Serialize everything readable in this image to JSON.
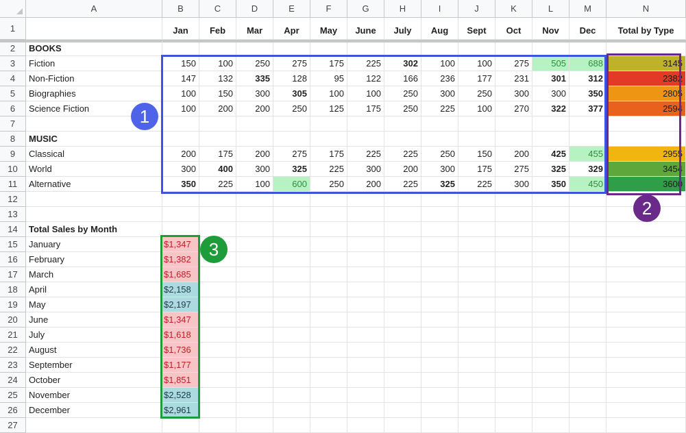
{
  "columns": [
    "A",
    "B",
    "C",
    "D",
    "E",
    "F",
    "G",
    "H",
    "I",
    "J",
    "K",
    "L",
    "M",
    "N"
  ],
  "rows": [
    "1",
    "2",
    "3",
    "4",
    "5",
    "6",
    "7",
    "8",
    "9",
    "10",
    "11",
    "12",
    "13",
    "14",
    "15",
    "16",
    "17",
    "18",
    "19",
    "20",
    "21",
    "22",
    "23",
    "24",
    "25",
    "26",
    "27"
  ],
  "month_headers": [
    "Jan",
    "Feb",
    "Mar",
    "Apr",
    "May",
    "June",
    "July",
    "Aug",
    "Sept",
    "Oct",
    "Nov",
    "Dec"
  ],
  "total_header": "Total by Type",
  "sections": {
    "books": "BOOKS",
    "music": "MUSIC"
  },
  "data_rows": [
    {
      "label": "Fiction",
      "values": [
        "150",
        "100",
        "250",
        "275",
        "175",
        "225",
        "302",
        "100",
        "100",
        "275",
        "505",
        "688"
      ],
      "bold": [
        false,
        false,
        false,
        false,
        false,
        false,
        true,
        false,
        false,
        false,
        false,
        false
      ],
      "green": [
        false,
        false,
        false,
        false,
        false,
        false,
        false,
        false,
        false,
        false,
        true,
        true
      ],
      "total": "3145",
      "total_color": "#bfb12a"
    },
    {
      "label": "Non-Fiction",
      "values": [
        "147",
        "132",
        "335",
        "128",
        "95",
        "122",
        "166",
        "236",
        "177",
        "231",
        "301",
        "312"
      ],
      "bold": [
        false,
        false,
        true,
        false,
        false,
        false,
        false,
        false,
        false,
        false,
        true,
        true
      ],
      "green": [
        false,
        false,
        false,
        false,
        false,
        false,
        false,
        false,
        false,
        false,
        false,
        false
      ],
      "total": "2382",
      "total_color": "#e23a26"
    },
    {
      "label": "Biographies",
      "values": [
        "100",
        "150",
        "300",
        "305",
        "100",
        "100",
        "250",
        "300",
        "250",
        "300",
        "300",
        "350"
      ],
      "bold": [
        false,
        false,
        false,
        true,
        false,
        false,
        false,
        false,
        false,
        false,
        false,
        true
      ],
      "green": [
        false,
        false,
        false,
        false,
        false,
        false,
        false,
        false,
        false,
        false,
        false,
        false
      ],
      "total": "2805",
      "total_color": "#ee9613"
    },
    {
      "label": "Science Fiction",
      "values": [
        "100",
        "200",
        "200",
        "250",
        "125",
        "175",
        "250",
        "225",
        "100",
        "270",
        "322",
        "377"
      ],
      "bold": [
        false,
        false,
        false,
        false,
        false,
        false,
        false,
        false,
        false,
        false,
        true,
        true
      ],
      "green": [
        false,
        false,
        false,
        false,
        false,
        false,
        false,
        false,
        false,
        false,
        false,
        false
      ],
      "total": "2594",
      "total_color": "#e8621e"
    },
    {
      "label": "Classical",
      "values": [
        "200",
        "175",
        "200",
        "275",
        "175",
        "225",
        "225",
        "250",
        "150",
        "200",
        "425",
        "455"
      ],
      "bold": [
        false,
        false,
        false,
        false,
        false,
        false,
        false,
        false,
        false,
        false,
        true,
        false
      ],
      "green": [
        false,
        false,
        false,
        false,
        false,
        false,
        false,
        false,
        false,
        false,
        false,
        true
      ],
      "total": "2955",
      "total_color": "#f0b50f"
    },
    {
      "label": "World",
      "values": [
        "300",
        "400",
        "300",
        "325",
        "225",
        "300",
        "200",
        "300",
        "175",
        "275",
        "325",
        "329"
      ],
      "bold": [
        false,
        true,
        false,
        true,
        false,
        false,
        false,
        false,
        false,
        false,
        true,
        true
      ],
      "green": [
        false,
        false,
        false,
        false,
        false,
        false,
        false,
        false,
        false,
        false,
        false,
        false
      ],
      "total": "3454",
      "total_color": "#5ea73b"
    },
    {
      "label": "Alternative",
      "values": [
        "350",
        "225",
        "100",
        "600",
        "250",
        "200",
        "225",
        "325",
        "225",
        "300",
        "350",
        "450"
      ],
      "bold": [
        true,
        false,
        false,
        false,
        false,
        false,
        false,
        true,
        false,
        false,
        true,
        false
      ],
      "green": [
        false,
        false,
        false,
        true,
        false,
        false,
        false,
        false,
        false,
        false,
        false,
        true
      ],
      "total": "3600",
      "total_color": "#2f9e49"
    }
  ],
  "monthly_title": "Total Sales by Month",
  "monthly": [
    {
      "month": "January",
      "value": "$1,347",
      "high": false
    },
    {
      "month": "February",
      "value": "$1,382",
      "high": false
    },
    {
      "month": "March",
      "value": "$1,685",
      "high": false
    },
    {
      "month": "April",
      "value": "$2,158",
      "high": true
    },
    {
      "month": "May",
      "value": "$2,197",
      "high": true
    },
    {
      "month": "June",
      "value": "$1,347",
      "high": false
    },
    {
      "month": "July",
      "value": "$1,618",
      "high": false
    },
    {
      "month": "August",
      "value": "$1,736",
      "high": false
    },
    {
      "month": "September",
      "value": "$1,177",
      "high": false
    },
    {
      "month": "October",
      "value": "$1,851",
      "high": false
    },
    {
      "month": "November",
      "value": "$2,528",
      "high": true
    },
    {
      "month": "December",
      "value": "$2,961",
      "high": true
    }
  ],
  "callouts": [
    {
      "label": "1",
      "color": "#4f63e8"
    },
    {
      "label": "2",
      "color": "#6a2a8a"
    },
    {
      "label": "3",
      "color": "#1e9c3a"
    }
  ],
  "colors": {
    "green_fill": "#b7f2c3",
    "green_text": "#2e8b3e",
    "low_fill": "#f7c5c5",
    "low_text": "#c0202a",
    "high_fill": "#abdbe0",
    "high_text": "#1f3b4a",
    "outline_blue": "#3b55e0",
    "outline_purple": "#6a2a8a",
    "outline_green": "#1e9c3a"
  }
}
